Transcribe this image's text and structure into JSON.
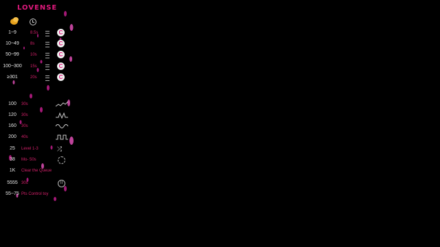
{
  "brand": {
    "logo": "LOVENSE",
    "accent": "#e0197d",
    "coin_color": "#e8a21c"
  },
  "header": {
    "tip_icon": "coins-icon",
    "time_icon": "clock-icon"
  },
  "levels": [
    {
      "tip": "1~9",
      "duration": "8.5s",
      "icon_letter": "C"
    },
    {
      "tip": "10~49",
      "duration": "8s",
      "icon_letter": "C"
    },
    {
      "tip": "50~99",
      "duration": "10s",
      "icon_letter": "C"
    },
    {
      "tip": "100~300",
      "duration": "15s",
      "icon_letter": "C"
    },
    {
      "tip": "≥301",
      "duration": "20s",
      "icon_letter": "C"
    }
  ],
  "specials": [
    {
      "tip": "100",
      "label": "30s",
      "icon": "wave-pattern-icon"
    },
    {
      "tip": "120",
      "label": "30s",
      "icon": "pulse-pattern-icon"
    },
    {
      "tip": "160",
      "label": "30s",
      "icon": "sine-pattern-icon"
    },
    {
      "tip": "200",
      "label": "40s",
      "icon": "square-pattern-icon"
    },
    {
      "tip": "25",
      "label": "Level 1-3",
      "icon": "shuffle-icon"
    },
    {
      "tip": "38",
      "label": "Mo- 50s",
      "icon": "gear-icon"
    },
    {
      "tip": "1K",
      "label": "Clear the Queue",
      "icon": ""
    },
    {
      "tip": "5555",
      "label": "30s",
      "icon": "pause-icon"
    },
    {
      "tip": "55~75",
      "label": "Pts  Control toy",
      "icon": ""
    }
  ]
}
